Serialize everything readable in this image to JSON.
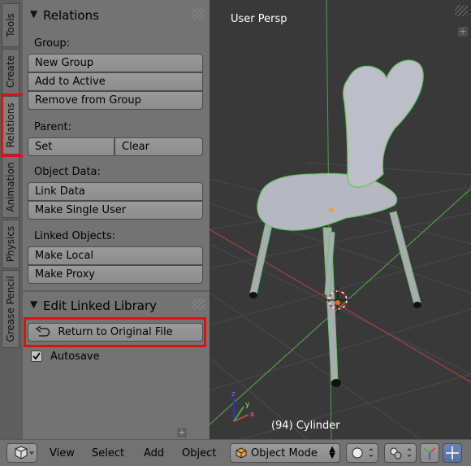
{
  "tabs": [
    "Tools",
    "Create",
    "Relations",
    "Animation",
    "Physics",
    "Grease Pencil"
  ],
  "relations": {
    "title": "Relations",
    "group_label": "Group:",
    "new_group": "New Group",
    "add_to_active": "Add to Active",
    "remove_from_group": "Remove from Group",
    "parent_label": "Parent:",
    "set": "Set",
    "clear": "Clear",
    "object_data_label": "Object Data:",
    "link_data": "Link Data",
    "make_single_user": "Make Single User",
    "linked_objects_label": "Linked Objects:",
    "make_local": "Make Local",
    "make_proxy": "Make Proxy"
  },
  "edit_linked": {
    "title": "Edit Linked Library",
    "return_button": "Return to Original File",
    "autosave": "Autosave",
    "autosave_checked": true
  },
  "viewport": {
    "view_name": "User Persp",
    "object_info": "(94) Cylinder"
  },
  "header": {
    "view": "View",
    "select": "Select",
    "add": "Add",
    "object": "Object",
    "mode": "Object Mode"
  },
  "colors": {
    "highlight": "#e01010",
    "x_axis": "#c04040",
    "y_axis": "#4fb04f",
    "selection": "#5fc85f"
  },
  "icons": [
    "view3d-icon",
    "undo-arrow-icon",
    "checkbox-icon",
    "cube-icon",
    "sphere-icon",
    "pivot-icon",
    "manipulator-icon"
  ]
}
